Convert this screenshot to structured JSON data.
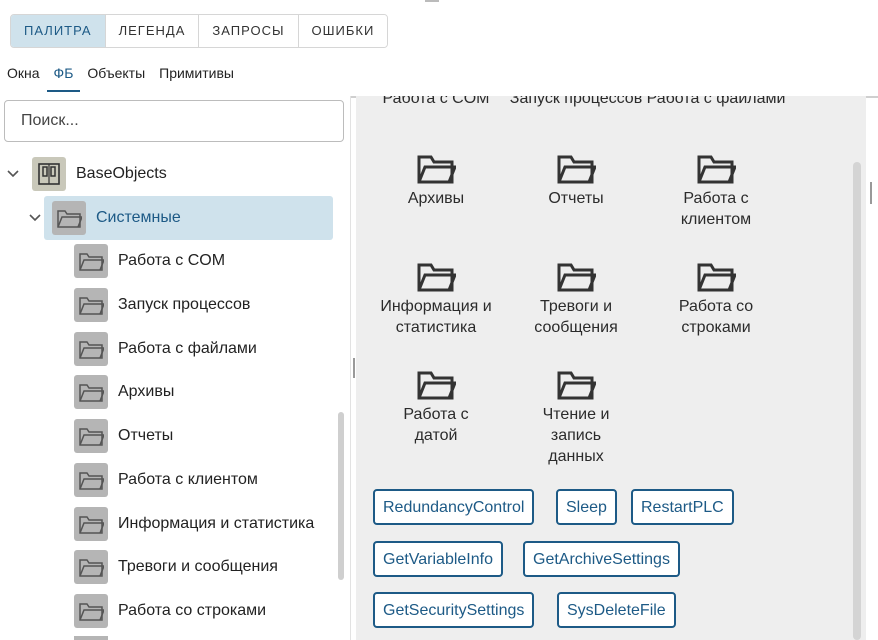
{
  "main_tabs": [
    "ПАЛИТРА",
    "ЛЕГЕНДА",
    "ЗАПРОСЫ",
    "ОШИБКИ"
  ],
  "sub_tabs": [
    "Окна",
    "ФБ",
    "Объекты",
    "Примитивы"
  ],
  "search": {
    "placeholder": "Поиск..."
  },
  "tree": {
    "root": "BaseObjects",
    "selected": "Системные",
    "children": [
      "Работа с COM",
      "Запуск процессов",
      "Работа с файлами",
      "Архивы",
      "Отчеты",
      "Работа с клиентом",
      "Информация и статистика",
      "Тревоги и сообщения",
      "Работа со строками"
    ]
  },
  "grid": {
    "partial": [
      "Работа с COM",
      "Запуск процессов",
      "Работа с файлами"
    ],
    "folders": [
      "Архивы",
      "Отчеты",
      "Работа с клиентом",
      "Информация и статистика",
      "Тревоги и сообщения",
      "Работа со строками",
      "Работа с датой",
      "Чтение и запись данных"
    ]
  },
  "blocks": [
    "RedundancyControl",
    "Sleep",
    "RestartPLC",
    "GetVariableInfo",
    "GetArchiveSettings",
    "GetSecuritySettings",
    "SysDeleteFile"
  ]
}
